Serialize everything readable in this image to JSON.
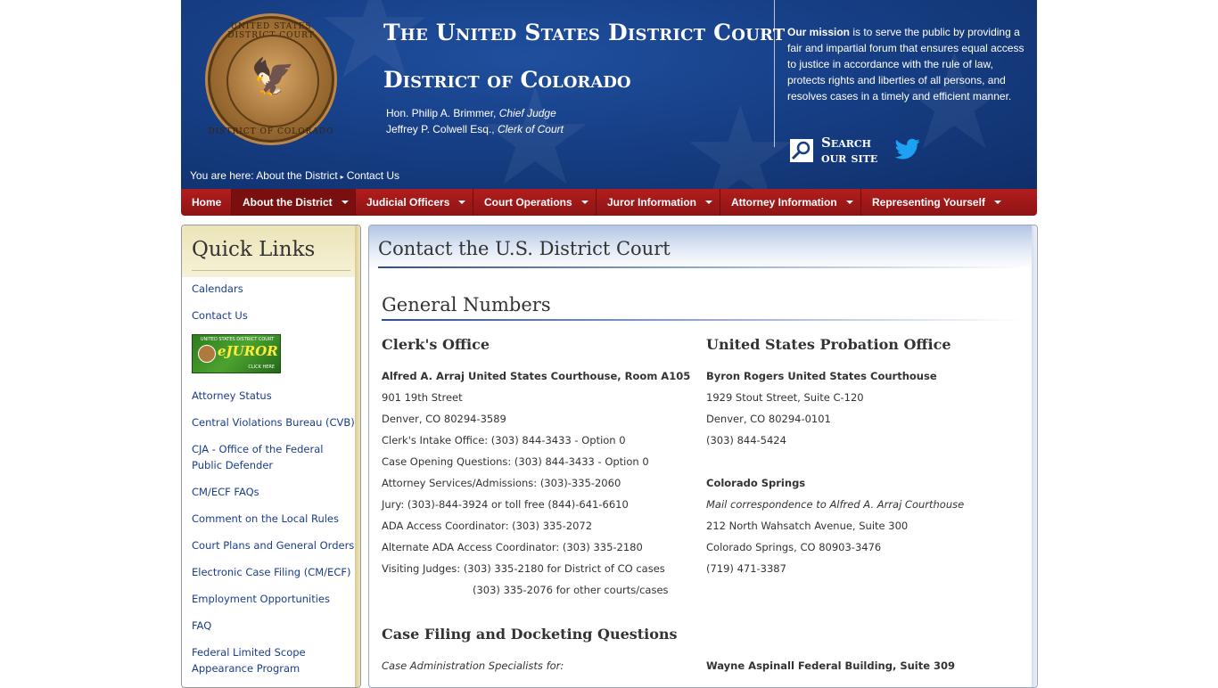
{
  "header": {
    "seal_top_text": "UNITED STATES DISTRICT COURT",
    "seal_bottom_text": "DISTRICT OF COLORADO",
    "court_title": "The United States District Court",
    "district_title": "District of Colorado",
    "judge_name": "Hon. Philip A. Brimmer, ",
    "judge_role": "Chief Judge",
    "clerk_name": "Jeffrey P. Colwell Esq., ",
    "clerk_role": "Clerk of Court",
    "mission_lead": "Our mission",
    "mission_text": " is to serve the public by providing a fair and impartial forum that ensures equal access to justice in accordance with the rule of law, protects rights and liberties of all persons, and resolves cases in a timely and efficient manner.",
    "search_line1": "Search",
    "search_line2": "our site",
    "breadcrumb_prefix": "You are here: ",
    "breadcrumb_1": "About the District",
    "breadcrumb_sep": "▸",
    "breadcrumb_2": "Contact Us"
  },
  "nav": {
    "items": [
      {
        "label": "Home"
      },
      {
        "label": "About the District"
      },
      {
        "label": "Judicial Officers"
      },
      {
        "label": "Court Operations"
      },
      {
        "label": "Juror Information"
      },
      {
        "label": "Attorney Information"
      },
      {
        "label": "Representing Yourself"
      }
    ]
  },
  "sidebar": {
    "title": "Quick Links",
    "ejuror_top": "UNITED STATES DISTRICT COURT",
    "ejuror_logo": "eJUROR",
    "ejuror_click": "CLICK HERE",
    "items": [
      "Calendars",
      "Contact Us",
      "Attorney Status",
      "Central Violations Bureau (CVB)",
      "CJA - Office of the Federal Public Defender",
      "CM/ECF FAQs",
      "Comment on the Local Rules",
      "Court Plans and General Orders",
      "Electronic Case Filing (CM/ECF)",
      "Employment Opportunities",
      "FAQ",
      "Federal Limited Scope Appearance Program"
    ]
  },
  "main": {
    "page_title": "Contact the U.S. District Court",
    "section1_title": "General Numbers",
    "clerk": {
      "heading": "Clerk's Office",
      "building": "Alfred A. Arraj United States Courthouse, Room A105",
      "street": "901 19th Street",
      "city": "Denver, CO 80294-3589",
      "intake": "Clerk's Intake Office: (303) 844-3433 - Option 0",
      "opening": "Case Opening Questions: (303) 844-3433 - Option 0",
      "attorney": "Attorney Services/Admissions: (303)-335-2060",
      "jury": "Jury: (303)-844-3924 or toll free (844)-641-6610",
      "ada": "ADA Access Coordinator: (303) 335-2072",
      "alt_ada": "Alternate ADA Access Coordinator: (303) 335-2180",
      "visiting1": "Visiting Judges:  (303) 335-2180 for District of CO cases",
      "visiting2": "(303) 335-2076 for other courts/cases"
    },
    "probation": {
      "heading": "United States Probation Office",
      "building": "Byron Rogers United States Courthouse",
      "street": "1929 Stout Street, Suite C-120",
      "city": "Denver, CO 80294-0101",
      "phone": "(303) 844-5424",
      "springs_title": "Colorado Springs",
      "springs_note": "Mail correspondence to Alfred A. Arraj Courthouse",
      "springs_street": "212 North Wahsatch Avenue, Suite 300",
      "springs_city": "Colorado Springs, CO  80903-3476",
      "springs_phone": "(719) 471-3387"
    },
    "section2_title": "Case Filing and Docketing Questions",
    "case_admin": "Case Administration Specialists for:",
    "aspinall": "Wayne Aspinall Federal Building, Suite 309"
  },
  "colors": {
    "header_blue": "#173f86",
    "nav_red": "#a51a1a",
    "link_blue": "#1a3d8a"
  }
}
